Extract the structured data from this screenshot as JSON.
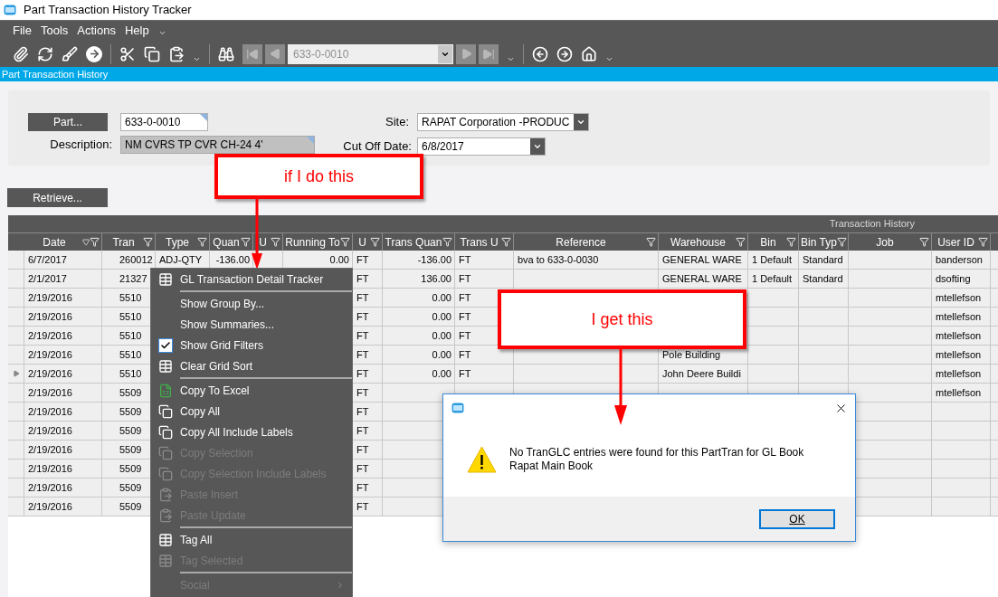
{
  "window": {
    "title": "Part Transaction History Tracker"
  },
  "menu_bar": [
    "File",
    "Tools",
    "Actions",
    "Help"
  ],
  "toolbar": {
    "navigator_value": "633-0-0010"
  },
  "section_title": "Part Transaction History",
  "form": {
    "part_button": "Part...",
    "part_value": "633-0-0010",
    "description_label": "Description:",
    "description_value": "NM CVRS TP CVR CH-24 4'",
    "site_label": "Site:",
    "site_value": "RAPAT Corporation -PRODUC",
    "cutoff_label": "Cut Off Date:",
    "cutoff_value": "6/8/2017"
  },
  "retrieve_button": "Retrieve...",
  "table": {
    "group_title": "Transaction History",
    "columns": [
      {
        "label": "Date",
        "sorted": true
      },
      {
        "label": "Tran",
        "sorted": false
      },
      {
        "label": "Type",
        "sorted": false
      },
      {
        "label": "Quan",
        "sorted": false
      },
      {
        "label": "U",
        "sorted": false
      },
      {
        "label": "Running To",
        "sorted": false
      },
      {
        "label": "U",
        "sorted": false
      },
      {
        "label": "Trans Quan",
        "sorted": false
      },
      {
        "label": "Trans U",
        "sorted": false
      },
      {
        "label": "Reference",
        "sorted": false
      },
      {
        "label": "Warehouse",
        "sorted": false
      },
      {
        "label": "Bin",
        "sorted": false
      },
      {
        "label": "Bin Typ",
        "sorted": false
      },
      {
        "label": "Job",
        "sorted": false
      },
      {
        "label": "User ID",
        "sorted": false
      }
    ],
    "rows": [
      {
        "current": false,
        "cells": [
          "6/7/2017",
          "260012",
          "ADJ-QTY",
          "-136.00",
          null,
          "0.00",
          "FT",
          "-136.00",
          "FT",
          "bva to 633-0-0030",
          "GENERAL WARE",
          "1 Default",
          "Standard",
          null,
          "banderson"
        ]
      },
      {
        "current": false,
        "cells": [
          "2/1/2017",
          "21327",
          null,
          null,
          null,
          null,
          "FT",
          "136.00",
          "FT",
          null,
          "GENERAL WARE",
          "1 Default",
          "Standard",
          null,
          "dsofting"
        ]
      },
      {
        "current": false,
        "cells": [
          "2/19/2016",
          "5510",
          null,
          null,
          null,
          null,
          "FT",
          "0.00",
          "FT",
          null,
          null,
          null,
          null,
          null,
          "mtellefson"
        ]
      },
      {
        "current": false,
        "cells": [
          "2/19/2016",
          "5510",
          null,
          null,
          null,
          null,
          "FT",
          "0.00",
          "FT",
          null,
          null,
          null,
          null,
          null,
          "mtellefson"
        ]
      },
      {
        "current": false,
        "cells": [
          "2/19/2016",
          "5510",
          null,
          null,
          null,
          null,
          "FT",
          "0.00",
          "FT",
          null,
          null,
          null,
          null,
          null,
          "mtellefson"
        ]
      },
      {
        "current": false,
        "cells": [
          "2/19/2016",
          "5510",
          null,
          null,
          null,
          null,
          "FT",
          "0.00",
          "FT",
          null,
          "Pole Building",
          null,
          null,
          null,
          "mtellefson"
        ]
      },
      {
        "current": true,
        "cells": [
          "2/19/2016",
          "5510",
          null,
          null,
          null,
          null,
          "FT",
          "0.00",
          "FT",
          null,
          "John Deere Buildi",
          null,
          null,
          null,
          "mtellefson"
        ]
      },
      {
        "current": false,
        "cells": [
          "2/19/2016",
          "5509",
          null,
          null,
          null,
          null,
          "FT",
          null,
          null,
          null,
          null,
          null,
          null,
          null,
          "mtellefson"
        ]
      },
      {
        "current": false,
        "cells": [
          "2/19/2016",
          "5509",
          null,
          null,
          null,
          null,
          "FT",
          null,
          null,
          null,
          null,
          null,
          null,
          null,
          null
        ]
      },
      {
        "current": false,
        "cells": [
          "2/19/2016",
          "5509",
          null,
          null,
          null,
          null,
          "FT",
          null,
          null,
          null,
          null,
          null,
          null,
          null,
          null
        ]
      },
      {
        "current": false,
        "cells": [
          "2/19/2016",
          "5509",
          null,
          null,
          null,
          null,
          "FT",
          null,
          null,
          null,
          null,
          null,
          null,
          null,
          null
        ]
      },
      {
        "current": false,
        "cells": [
          "2/19/2016",
          "5509",
          null,
          null,
          null,
          null,
          "FT",
          null,
          null,
          null,
          null,
          null,
          null,
          null,
          null
        ]
      },
      {
        "current": false,
        "cells": [
          "2/19/2016",
          "5509",
          null,
          null,
          null,
          null,
          "FT",
          null,
          null,
          null,
          null,
          null,
          null,
          null,
          null
        ]
      },
      {
        "current": false,
        "cells": [
          "2/19/2016",
          "5509",
          null,
          null,
          null,
          null,
          "FT",
          null,
          null,
          null,
          null,
          null,
          null,
          null,
          null
        ]
      }
    ]
  },
  "context_menu": [
    {
      "kind": "tracker",
      "label": "GL Transaction Detail Tracker",
      "disabled": false
    },
    {
      "kind": "separator"
    },
    {
      "kind": "plain",
      "label": "Show Group By...",
      "disabled": false
    },
    {
      "kind": "plain",
      "label": "Show Summaries...",
      "disabled": false
    },
    {
      "kind": "check",
      "label": "Show Grid Filters",
      "disabled": false,
      "checked": true
    },
    {
      "kind": "tracker",
      "label": "Clear Grid Sort",
      "disabled": false
    },
    {
      "kind": "separator"
    },
    {
      "kind": "excel",
      "label": "Copy To Excel",
      "disabled": false
    },
    {
      "kind": "copy",
      "label": "Copy All",
      "disabled": false
    },
    {
      "kind": "copy",
      "label": "Copy All Include Labels",
      "disabled": false
    },
    {
      "kind": "copy",
      "label": "Copy Selection",
      "disabled": true
    },
    {
      "kind": "copy",
      "label": "Copy Selection Include Labels",
      "disabled": true
    },
    {
      "kind": "paste",
      "label": "Paste Insert",
      "disabled": true
    },
    {
      "kind": "paste",
      "label": "Paste Update",
      "disabled": true
    },
    {
      "kind": "separator"
    },
    {
      "kind": "tracker",
      "label": "Tag All",
      "disabled": false
    },
    {
      "kind": "tracker",
      "label": "Tag Selected",
      "disabled": true
    },
    {
      "kind": "separator"
    },
    {
      "kind": "submenu",
      "label": "Social",
      "disabled": true
    }
  ],
  "dialog": {
    "message": "No TranGLC entries were found for this PartTran for GL Book Rapat Main Book",
    "ok_button": "OK"
  },
  "callouts": [
    {
      "text": "if I do this"
    },
    {
      "text": "I get this"
    }
  ]
}
